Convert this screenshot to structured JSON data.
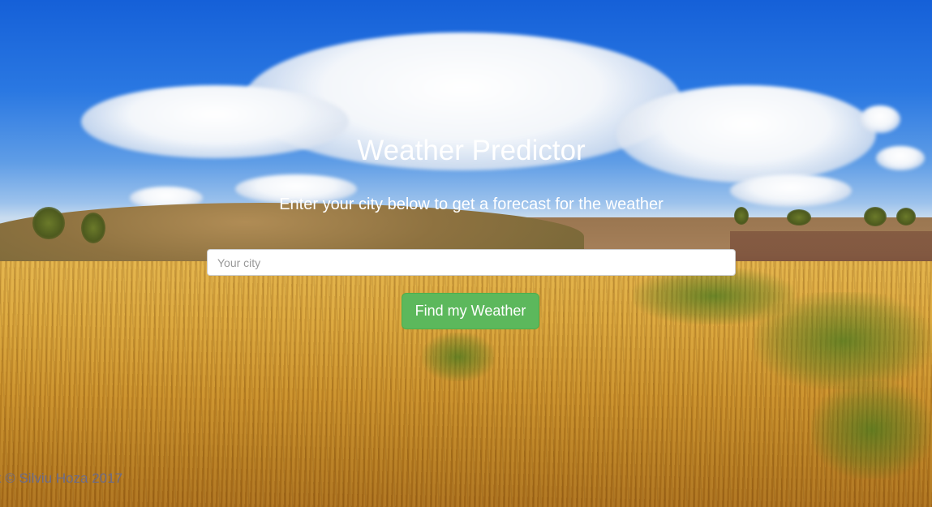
{
  "app": {
    "title": "Weather Predictor",
    "subtitle": "Enter your city below to get a forecast for the weather"
  },
  "search": {
    "placeholder": "Your city",
    "value": ""
  },
  "actions": {
    "find_label": "Find my Weather"
  },
  "footer": {
    "text": "k © Silviu Hoza 2017"
  },
  "colors": {
    "button_green": "#5cb85c",
    "text_white": "#ffffff"
  }
}
